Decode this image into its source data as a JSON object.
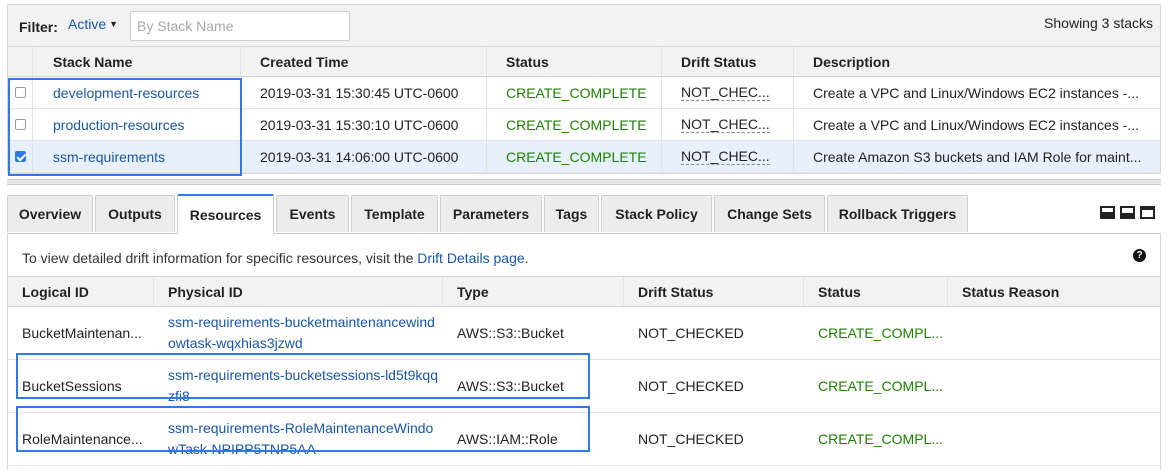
{
  "filter": {
    "label": "Filter:",
    "dropdown_value": "Active",
    "search_placeholder": "By Stack Name",
    "showing": "Showing 3 stacks"
  },
  "stacks": {
    "headers": [
      "Stack Name",
      "Created Time",
      "Status",
      "Drift Status",
      "Description"
    ],
    "rows": [
      {
        "selected": false,
        "name": "development-resources",
        "created": "2019-03-31 15:30:45 UTC-0600",
        "status": "CREATE_COMPLETE",
        "drift": "NOT_CHEC...",
        "description": "Create a VPC and Linux/Windows EC2 instances -..."
      },
      {
        "selected": false,
        "name": "production-resources",
        "created": "2019-03-31 15:30:10 UTC-0600",
        "status": "CREATE_COMPLETE",
        "drift": "NOT_CHEC...",
        "description": "Create a VPC and Linux/Windows EC2 instances -..."
      },
      {
        "selected": true,
        "name": "ssm-requirements",
        "created": "2019-03-31 14:06:00 UTC-0600",
        "status": "CREATE_COMPLETE",
        "drift": "NOT_CHEC...",
        "description": "Create Amazon S3 buckets and IAM Role for maint..."
      }
    ]
  },
  "tabs": [
    {
      "label": "Overview",
      "active": false
    },
    {
      "label": "Outputs",
      "active": false
    },
    {
      "label": "Resources",
      "active": true
    },
    {
      "label": "Events",
      "active": false
    },
    {
      "label": "Template",
      "active": false
    },
    {
      "label": "Parameters",
      "active": false
    },
    {
      "label": "Tags",
      "active": false
    },
    {
      "label": "Stack Policy",
      "active": false
    },
    {
      "label": "Change Sets",
      "active": false
    },
    {
      "label": "Rollback Triggers",
      "active": false
    }
  ],
  "layout_icons": [
    "panel-bottom-large-icon",
    "panel-bottom-small-icon",
    "panel-top-icon"
  ],
  "resources": {
    "info_text": "To view detailed drift information for specific resources, visit the ",
    "info_link": "Drift Details page",
    "info_end": ".",
    "help_icon": "question-circle-icon",
    "headers": [
      "Logical ID",
      "Physical ID",
      "Type",
      "Drift Status",
      "Status",
      "Status Reason"
    ],
    "rows": [
      {
        "logical_id": "BucketMaintenan...",
        "physical_id": "ssm-requirements-bucketmaintenancewindowtask-wqxhias3jzwd",
        "type": "AWS::S3::Bucket",
        "drift": "NOT_CHECKED",
        "status": "CREATE_COMPL...",
        "reason": ""
      },
      {
        "logical_id": "BucketSessions",
        "physical_id": "ssm-requirements-bucketsessions-ld5t9kqqzfi8",
        "type": "AWS::S3::Bucket",
        "drift": "NOT_CHECKED",
        "status": "CREATE_COMPL...",
        "reason": ""
      },
      {
        "logical_id": "RoleMaintenance...",
        "physical_id": "ssm-requirements-RoleMaintenanceWindowTask-NPIPP5TNP5AA",
        "type": "AWS::IAM::Role",
        "drift": "NOT_CHECKED",
        "status": "CREATE_COMPL...",
        "reason": ""
      }
    ]
  }
}
